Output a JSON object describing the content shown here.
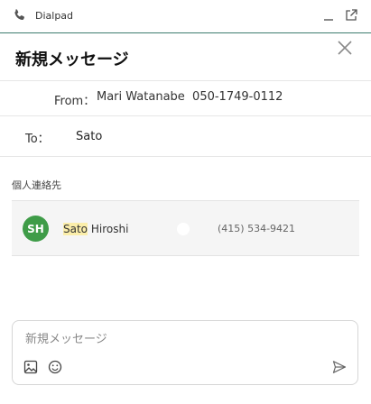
{
  "titlebar": {
    "app_name": "Dialpad",
    "phone_icon": "phone-icon",
    "minimize_icon": "minimize-icon",
    "popout_icon": "popout-icon"
  },
  "header": {
    "title": "新規メッセージ",
    "close_icon": "close-icon"
  },
  "from": {
    "label": "From：",
    "value": "Mari Watanabe  050-1749-0112"
  },
  "to": {
    "label": "To：",
    "value": "Sato"
  },
  "contacts": {
    "section_label": "個人連絡先",
    "items": [
      {
        "initials": "SH",
        "name_match": "Sato",
        "name_rest": " Hiroshi",
        "phone": "(415) 534-9421",
        "avatar_color": "#3f9c48"
      }
    ]
  },
  "composer": {
    "placeholder": "新規メッセージ",
    "value": "",
    "image_icon": "image-icon",
    "emoji_icon": "emoji-icon",
    "send_icon": "send-icon"
  },
  "colors": {
    "accent_line": "#3d7c6f",
    "highlight": "#fbeeaa",
    "row_bg": "#f5f5f5"
  }
}
